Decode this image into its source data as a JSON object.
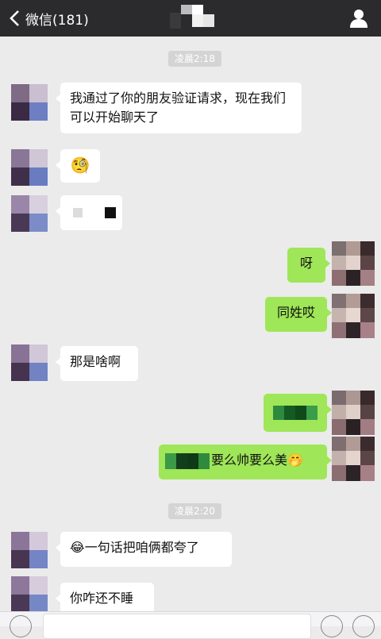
{
  "header": {
    "back_label": "微信(181)",
    "back_icon": "chevron-left-icon",
    "profile_icon": "person-icon",
    "bg_color": "#2b2b2e"
  },
  "timestamps": [
    "凌晨2:18",
    "凌晨2:20"
  ],
  "messages": [
    {
      "side": "in",
      "text": "我通过了你的朋友验证请求，现在我们可以开始聊天了"
    },
    {
      "side": "in",
      "type": "emoji",
      "emoji": "🧐"
    },
    {
      "side": "in",
      "type": "redacted"
    },
    {
      "side": "out",
      "text": "呀"
    },
    {
      "side": "out",
      "text": "同姓哎"
    },
    {
      "side": "in",
      "text": "那是啥啊"
    },
    {
      "side": "out",
      "type": "redacted"
    },
    {
      "side": "out",
      "text": "要么帅要么美",
      "emoji": "🤭"
    },
    {
      "side": "in",
      "text": "一句话把咱俩都夸了",
      "emoji": "😂"
    },
    {
      "side": "in",
      "text": "你咋还不睡"
    }
  ],
  "colors": {
    "incoming_bubble": "#ffffff",
    "outgoing_bubble": "#9fe658",
    "chat_background": "#ebebeb"
  }
}
